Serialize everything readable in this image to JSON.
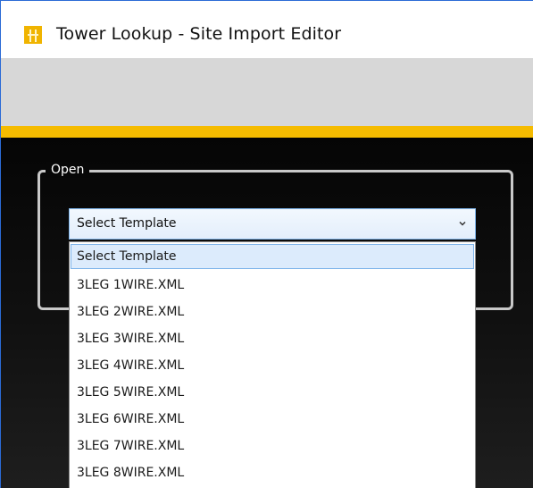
{
  "window": {
    "title": "Tower Lookup - Site Import Editor",
    "icon": "tower-icon"
  },
  "colors": {
    "accent": "#f5bb00",
    "toolbar": "#d7d7d7",
    "content_background": "#111111",
    "selection": "#dcebfc",
    "selection_border": "#7eb4ea"
  },
  "open_group": {
    "legend": "Open",
    "template_select": {
      "selected_value": "Select Template",
      "expanded": true,
      "options": [
        "Select Template",
        "3LEG 1WIRE.XML",
        "3LEG 2WIRE.XML",
        "3LEG 3WIRE.XML",
        "3LEG 4WIRE.XML",
        "3LEG 5WIRE.XML",
        "3LEG 6WIRE.XML",
        "3LEG 7WIRE.XML",
        "3LEG 8WIRE.XML"
      ]
    }
  }
}
